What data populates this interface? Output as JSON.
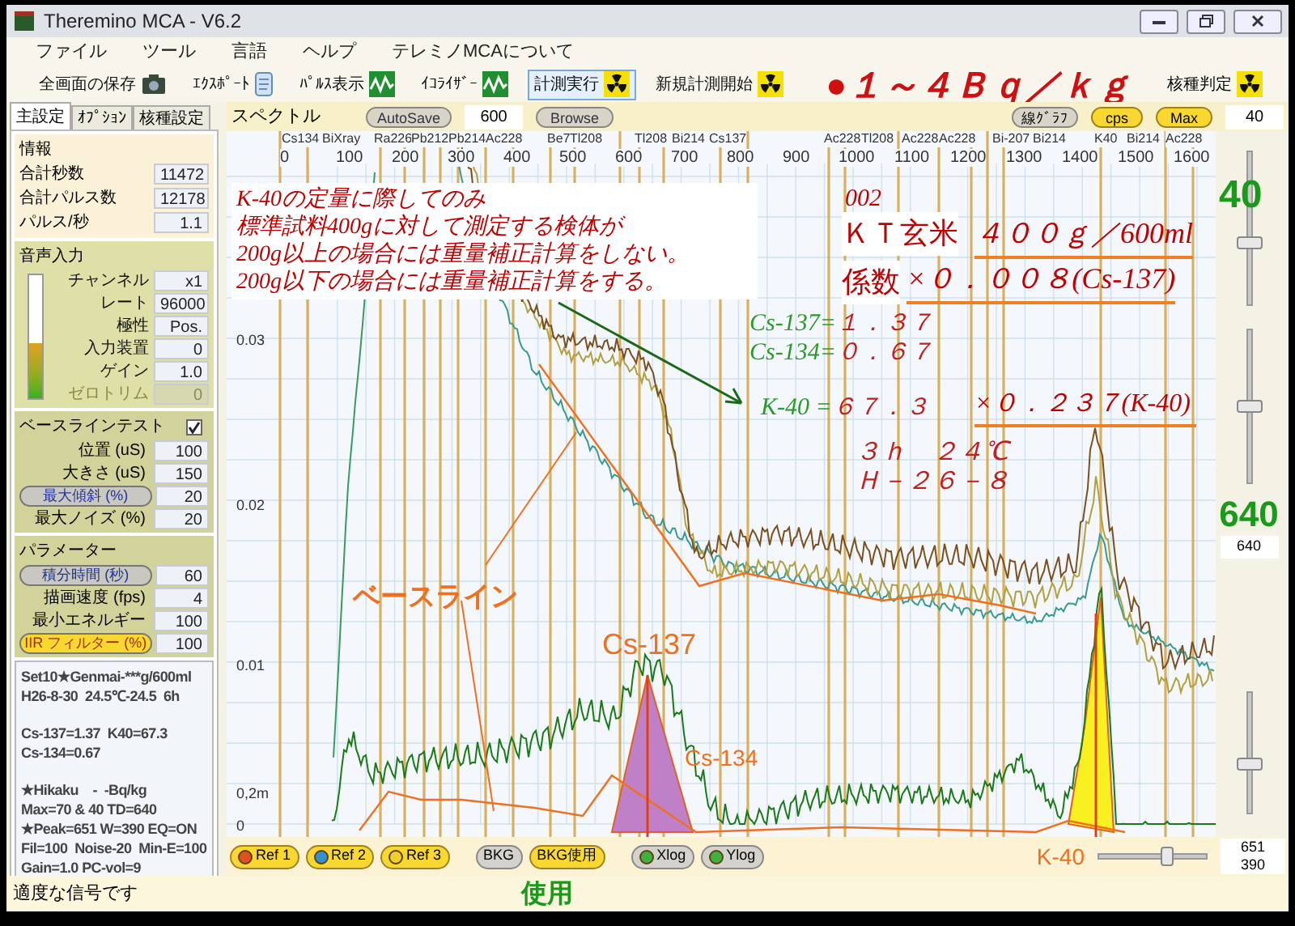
{
  "window": {
    "title": "Theremino MCA - V6.2"
  },
  "menu": [
    "ファイル",
    "ツール",
    "言語",
    "ヘルプ",
    "テレミノMCAについて"
  ],
  "toolbar": [
    {
      "label": "全画面の保存",
      "kind": "camera",
      "selected": false
    },
    {
      "label": "ｴｸｽﾎﾟｰﾄ",
      "kind": "scroll",
      "selected": false
    },
    {
      "label": "ﾊﾟﾙｽ表示",
      "kind": "wave",
      "selected": false
    },
    {
      "label": "ｲｺﾗｲｻﾞｰ",
      "kind": "wave",
      "selected": false
    },
    {
      "label": "計測実行",
      "kind": "radiation",
      "selected": true
    },
    {
      "label": "新規計測開始",
      "kind": "radiation",
      "selected": false
    }
  ],
  "headline": "●１～４Ｂｑ／ｋｇ",
  "toolbar_right": {
    "label": "核種判定",
    "kind": "radiation"
  },
  "tabs": [
    {
      "label": "主設定",
      "selected": true
    },
    {
      "label": "ｵﾌﾟｼｮﾝ",
      "selected": false
    },
    {
      "label": "核種設定",
      "selected": false
    }
  ],
  "info": {
    "title": "情報",
    "rows": [
      {
        "label": "合計秒数",
        "value": "11472"
      },
      {
        "label": "合計パルス数",
        "value": "12178"
      },
      {
        "label": "パルス/秒",
        "value": "1.1"
      }
    ]
  },
  "audio": {
    "title": "音声入力",
    "level": 0.45,
    "rows": [
      {
        "label": "チャンネル",
        "value": "x1",
        "disabled": false
      },
      {
        "label": "レート",
        "value": "96000",
        "disabled": false
      },
      {
        "label": "極性",
        "value": "Pos.",
        "disabled": false
      },
      {
        "label": "入力装置",
        "value": "0",
        "disabled": false
      },
      {
        "label": "ゲイン",
        "value": "1.0",
        "disabled": false
      },
      {
        "label": "ゼロトリム",
        "value": "0",
        "disabled": true
      }
    ]
  },
  "baseline": {
    "title": "ベースラインテスト",
    "checked": true,
    "rows": [
      {
        "kind": "label",
        "label": "位置 (uS)",
        "value": "100"
      },
      {
        "kind": "label",
        "label": "大きさ (uS)",
        "value": "150"
      },
      {
        "kind": "button",
        "label": "最大傾斜 (%)",
        "value": "20"
      },
      {
        "kind": "label",
        "label": "最大ノイズ (%)",
        "value": "20"
      }
    ]
  },
  "params": {
    "title": "パラメーター",
    "rows": [
      {
        "kind": "button",
        "label": "積分時間 (秒)",
        "value": "60"
      },
      {
        "kind": "label",
        "label": "描画速度 (fps)",
        "value": "4"
      },
      {
        "kind": "label",
        "label": "最小エネルギー",
        "value": "100"
      },
      {
        "kind": "button_on",
        "label": "IIR フィルター (%)",
        "value": "100"
      }
    ]
  },
  "notes": [
    [
      "Set10★Genmai-***g/600ml",
      "H26-8-30  24.5℃-24.5  6h"
    ],
    [
      "Cs-137=1.37  K40=67.3",
      "Cs-134=0.67"
    ],
    [
      "★Hikaku    -  -Bq/kg",
      "Max=70 & 40 TD=640",
      "★Peak=651 W=390 EQ=ON",
      "Fil=100  Noise-20  Min-E=100",
      "Gain=1.0 PC-vol=9"
    ]
  ],
  "spectrum": {
    "title": "スペクトル",
    "autosave": "AutoSave",
    "autosave_value": "600",
    "browse": "Browse",
    "graph_button": "線ｸﾞﾗﾌ",
    "cps": "cps",
    "max": "Max",
    "max_value": "40",
    "isotope_labels": [
      "Cs134",
      "BiXray",
      "Ra226",
      "Pb212",
      "Pb214",
      "Ac228",
      "Be7",
      "Tl208",
      "Tl208",
      "Bi214",
      "Cs137",
      "Ac228",
      "Tl208",
      "Ac228",
      "Ac228",
      "Bi-207",
      "Bi214",
      "K40",
      "Bi214",
      "Ac228"
    ],
    "x_ticks": [
      "0",
      "100",
      "200",
      "300",
      "400",
      "500",
      "600",
      "700",
      "800",
      "900",
      "1000",
      "1100",
      "1200",
      "1300",
      "1400",
      "1500",
      "1600"
    ],
    "y_ticks": [
      "0.03",
      "0.02",
      "0.01",
      "0,2m",
      "0"
    ]
  },
  "annotations": {
    "note": [
      "K-40の定量に際してのみ",
      "標準試料400gに対して測定する検体が",
      "200g以上の場合には重量補正計算をしない。",
      "200g以下の場合には重量補正計算をする。"
    ],
    "sample_no": "002",
    "sample_name": "ＫＴ玄米",
    "sample_amount": "４００ｇ／600ml",
    "factor_label": "係数",
    "factor_value": "×０．００８(Cs-137)",
    "results": [
      {
        "label": "Cs-137=",
        "value": "１．３７"
      },
      {
        "label": "Cs-134=",
        "value": "０．６７"
      },
      {
        "label": "K-40 =",
        "value": "６７．３"
      }
    ],
    "k40_factor": "×０．２３７(K-40)",
    "conditions": [
      "３ｈ　２４℃",
      "Ｈ－２６－８"
    ],
    "baseline_label": "ベースライン",
    "peaks": [
      "Cs-137",
      "Cs-134",
      "K-40"
    ],
    "used_label": "使用"
  },
  "right_panel": {
    "max_slider": {
      "label": "40",
      "level": 0.4
    },
    "td_slider": {
      "label": "640",
      "value": "640",
      "level": 0.5
    },
    "lower_slider": {
      "level": 0.4
    }
  },
  "bottom_buttons": [
    {
      "label": "Ref 1",
      "kind": "accent",
      "color": "#e05020"
    },
    {
      "label": "Ref 2",
      "kind": "accent",
      "color": "#3090d0"
    },
    {
      "label": "Ref 3",
      "kind": "accent",
      "color": "#f0d030"
    },
    {
      "label": "BKG",
      "kind": "plain"
    },
    {
      "label": "BKG使用",
      "kind": "accent"
    },
    {
      "label": "Xlog",
      "kind": "plain",
      "color": "#40b040"
    },
    {
      "label": "Ylog",
      "kind": "plain",
      "color": "#40b040"
    }
  ],
  "bottom_slider": {
    "level": 0.65,
    "values": [
      "651",
      "390"
    ]
  },
  "status_bar": "適度な信号です"
}
